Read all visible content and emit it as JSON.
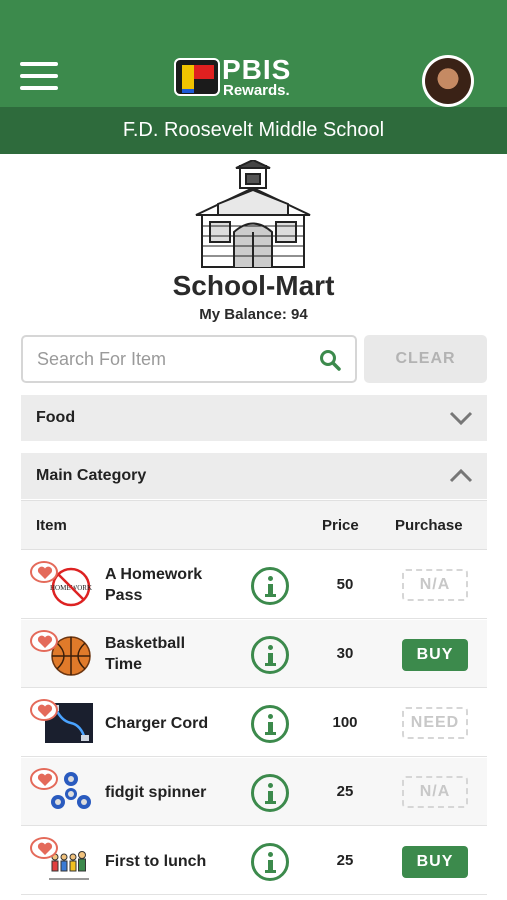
{
  "header": {
    "logo_main": "PBIS",
    "logo_sub": "Rewards.",
    "school_name": "F.D. Roosevelt Middle School"
  },
  "store": {
    "title": "School-Mart",
    "balance_text": "My Balance: 94"
  },
  "search": {
    "placeholder": "Search For Item",
    "value": "",
    "clear_label": "CLEAR"
  },
  "categories": [
    {
      "label": "Food",
      "expanded": false
    },
    {
      "label": "Main Category",
      "expanded": true
    }
  ],
  "table": {
    "columns": [
      "Item",
      "Price",
      "Purchase"
    ],
    "rows": [
      {
        "name_line1": "A Homework",
        "name_line2": "Pass",
        "price": "50",
        "purchase": "N/A",
        "purchase_type": "disabled",
        "thumb": "no-homework-icon"
      },
      {
        "name_line1": "Basketball",
        "name_line2": "Time",
        "price": "30",
        "purchase": "BUY",
        "purchase_type": "buy",
        "thumb": "basketball-icon"
      },
      {
        "name_line1": "Charger Cord",
        "name_line2": "",
        "price": "100",
        "purchase": "NEED",
        "purchase_type": "disabled",
        "thumb": "charger-cord-icon"
      },
      {
        "name_line1": "fidgit spinner",
        "name_line2": "",
        "price": "25",
        "purchase": "N/A",
        "purchase_type": "disabled",
        "thumb": "fidget-spinner-icon"
      },
      {
        "name_line1": "First to lunch",
        "name_line2": "",
        "price": "25",
        "purchase": "BUY",
        "purchase_type": "buy",
        "thumb": "lunch-line-icon"
      }
    ]
  },
  "colors": {
    "brand_green": "#3c8a4c",
    "school_bar": "#2e6b3c",
    "favorite_heart": "#e46a5a"
  }
}
